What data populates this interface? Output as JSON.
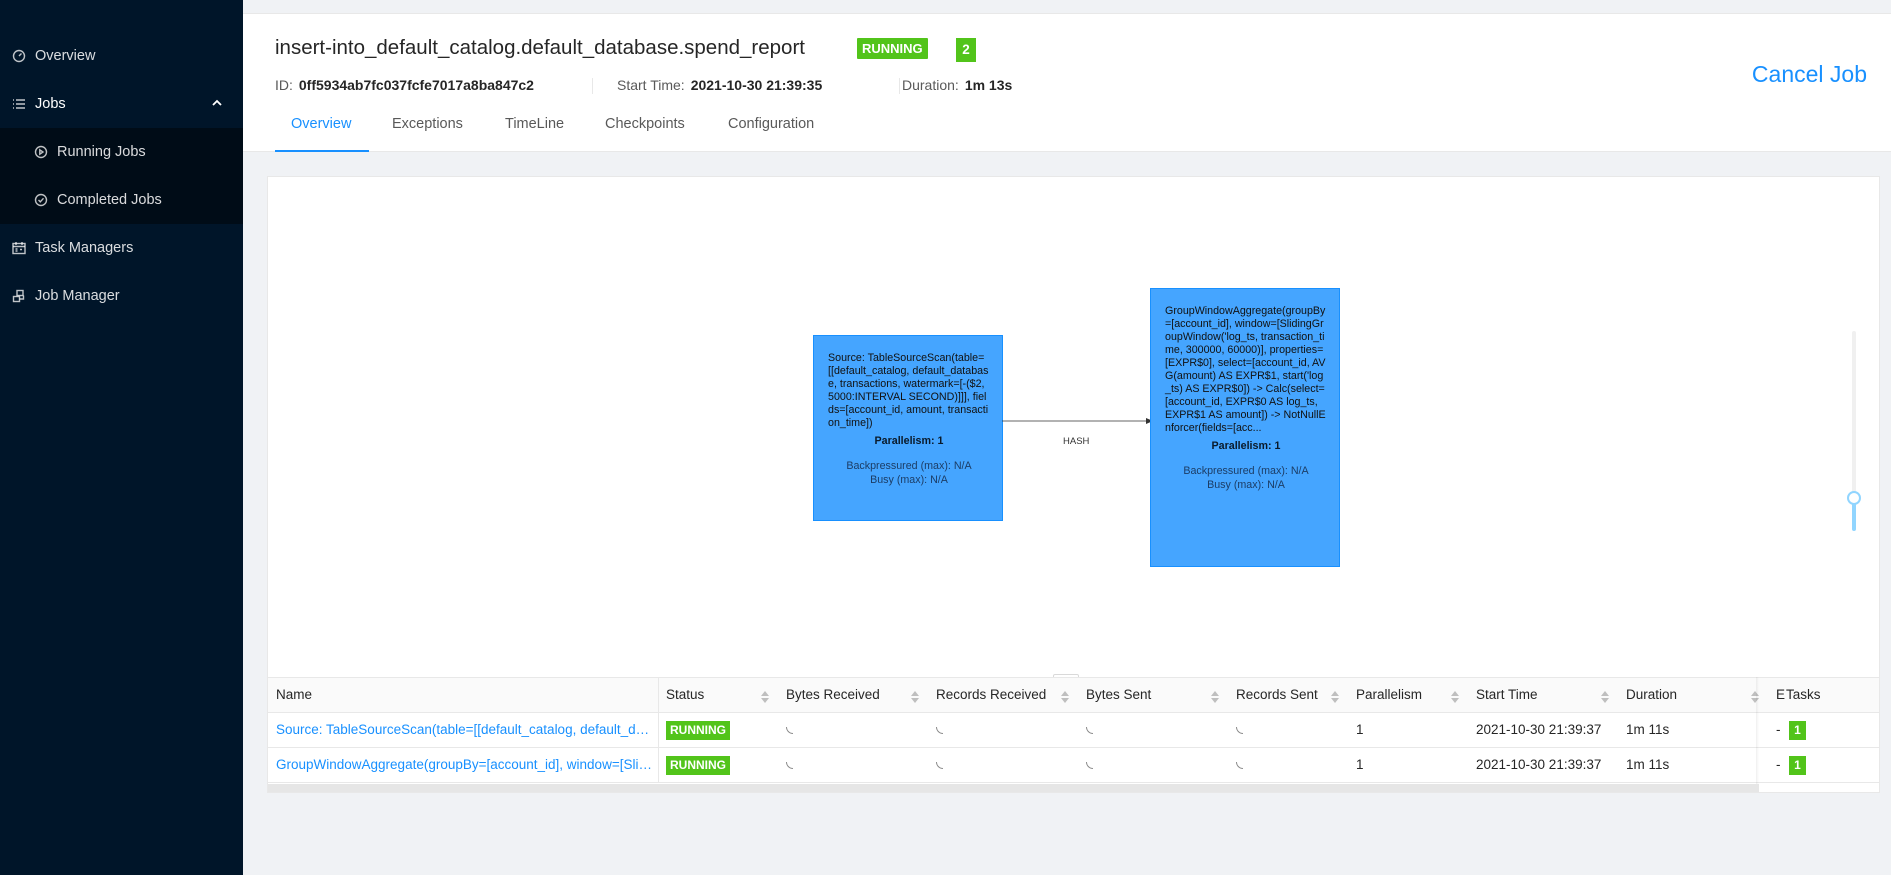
{
  "sidebar": {
    "items": [
      {
        "label": "Overview",
        "icon": "dashboard-icon"
      },
      {
        "label": "Jobs",
        "icon": "list-icon"
      },
      {
        "label": "Running Jobs",
        "icon": "play-circle-icon"
      },
      {
        "label": "Completed Jobs",
        "icon": "check-circle-icon"
      },
      {
        "label": "Task Managers",
        "icon": "schedule-icon"
      },
      {
        "label": "Job Manager",
        "icon": "cluster-icon"
      }
    ]
  },
  "header": {
    "title": "insert-into_default_catalog.default_database.spend_report",
    "status": "RUNNING",
    "task_count": "2",
    "id_label": "ID:",
    "id_value": "0ff5934ab7fc037fcfe7017a8ba847c2",
    "start_label": "Start Time:",
    "start_value": "2021-10-30 21:39:35",
    "duration_label": "Duration:",
    "duration_value": "1m 13s",
    "cancel_label": "Cancel Job",
    "tabs": [
      "Overview",
      "Exceptions",
      "TimeLine",
      "Checkpoints",
      "Configuration"
    ],
    "active_tab": "Overview"
  },
  "graph": {
    "nodes": [
      {
        "description": "Source: TableSourceScan(table=[[default_catalog, default_database, transactions, watermark=[-($2, 5000:INTERVAL SECOND)]]], fields=[account_id, amount, transaction_time])",
        "parallelism": "Parallelism: 1",
        "backpressured": "Backpressured (max): N/A",
        "busy": "Busy (max): N/A"
      },
      {
        "description": "GroupWindowAggregate(groupBy=[account_id], window=[SlidingGroupWindow('log_ts, transaction_time, 300000, 60000)], properties=[EXPR$0], select=[account_id, AVG(amount) AS EXPR$1, start('log_ts) AS EXPR$0]) -> Calc(select=[account_id, EXPR$0 AS log_ts, EXPR$1 AS amount]) -> NotNullEnforcer(fields=[acc...",
        "parallelism": "Parallelism: 1",
        "backpressured": "Backpressured (max): N/A",
        "busy": "Busy (max): N/A"
      }
    ],
    "edge_label": "HASH",
    "resize_label": "..."
  },
  "table": {
    "columns": [
      "Name",
      "Status",
      "Bytes Received",
      "Records Received",
      "Bytes Sent",
      "Records Sent",
      "Parallelism",
      "Start Time",
      "Duration",
      "E",
      "Tasks"
    ],
    "rows": [
      {
        "name": "Source: TableSourceScan(table=[[default_catalog, default_datab...",
        "status": "RUNNING",
        "parallelism": "1",
        "start_time": "2021-10-30 21:39:37",
        "duration": "1m 11s",
        "end": "-",
        "tasks": "1"
      },
      {
        "name": "GroupWindowAggregate(groupBy=[account_id], window=[Sliding...",
        "status": "RUNNING",
        "parallelism": "1",
        "start_time": "2021-10-30 21:39:37",
        "duration": "1m 11s",
        "end": "-",
        "tasks": "1"
      }
    ]
  },
  "colors": {
    "sidebar_bg": "#001529",
    "accent": "#1890ff",
    "running": "#52c41a",
    "node_fill": "#45a5ff"
  }
}
